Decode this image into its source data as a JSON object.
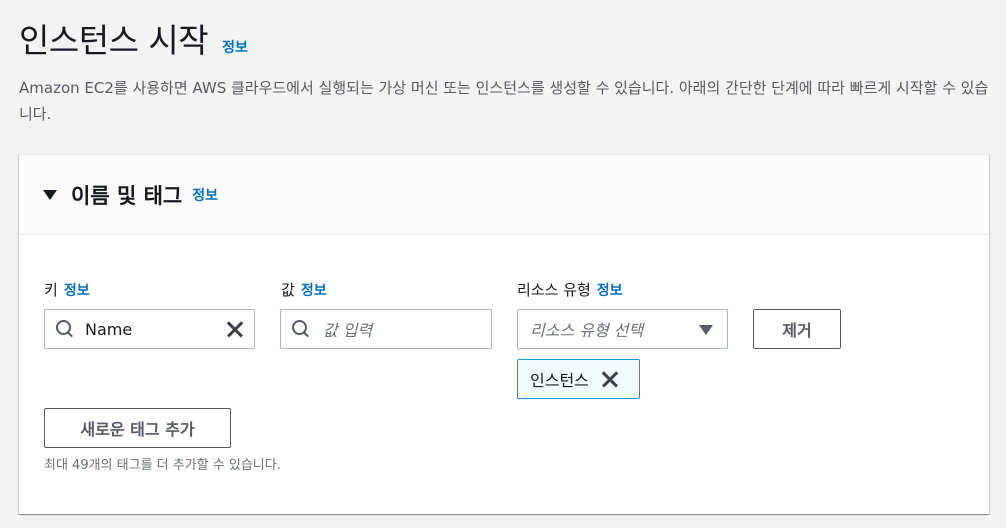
{
  "header": {
    "title": "인스턴스 시작",
    "info": "정보",
    "description": "Amazon EC2를 사용하면 AWS 클라우드에서 실행되는 가상 머신 또는 인스턴스를 생성할 수 있습니다. 아래의 간단한 단계에 따라 빠르게 시작할 수 있습니다."
  },
  "section": {
    "title": "이름 및 태그",
    "info": "정보"
  },
  "tag_row": {
    "key": {
      "label": "키",
      "info": "정보",
      "value": "Name"
    },
    "value": {
      "label": "값",
      "info": "정보",
      "placeholder": "값 입력"
    },
    "resource_type": {
      "label": "리소스 유형",
      "info": "정보",
      "placeholder": "리소스 유형 선택",
      "selected_tokens": [
        "인스턴스"
      ]
    },
    "remove_label": "제거"
  },
  "add_tag_label": "새로운 태그 추가",
  "hint": "최대 49개의 태그를 더 추가할 수 있습니다.",
  "colors": {
    "link": "#0073bb",
    "token_bg": "#f1faff",
    "token_border": "#00a1c9"
  }
}
